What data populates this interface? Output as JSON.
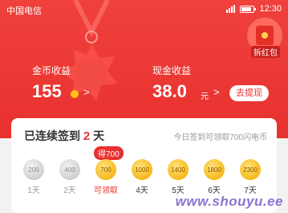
{
  "status_bar": {
    "carrier": "中国电信",
    "time": "12:30"
  },
  "red_packet": {
    "label": "拆红包"
  },
  "coin_income": {
    "label": "金币收益",
    "value": "155",
    "arrow": ">"
  },
  "cash_income": {
    "label": "现金收益",
    "value": "38.0",
    "unit": "元",
    "arrow": ">",
    "withdraw_label": "去提现"
  },
  "checkin": {
    "title_prefix": "已连续签到",
    "days": "2",
    "title_suffix": "天",
    "hint": "今日签到可领取700闪电币",
    "tooltip": "得700",
    "items": [
      {
        "coin": "200",
        "label": "1天"
      },
      {
        "coin": "400",
        "label": "2天"
      },
      {
        "coin": "700",
        "label": "可领取"
      },
      {
        "coin": "1000",
        "label": "4天"
      },
      {
        "coin": "1400",
        "label": "5天"
      },
      {
        "coin": "1800",
        "label": "6天"
      },
      {
        "coin": "2300",
        "label": "7天"
      }
    ]
  },
  "watermark": "www.shouyu.ee",
  "colors": {
    "primary_red": "#e8312f",
    "gold": "#f7b91c",
    "silver": "#cfcfcf"
  }
}
